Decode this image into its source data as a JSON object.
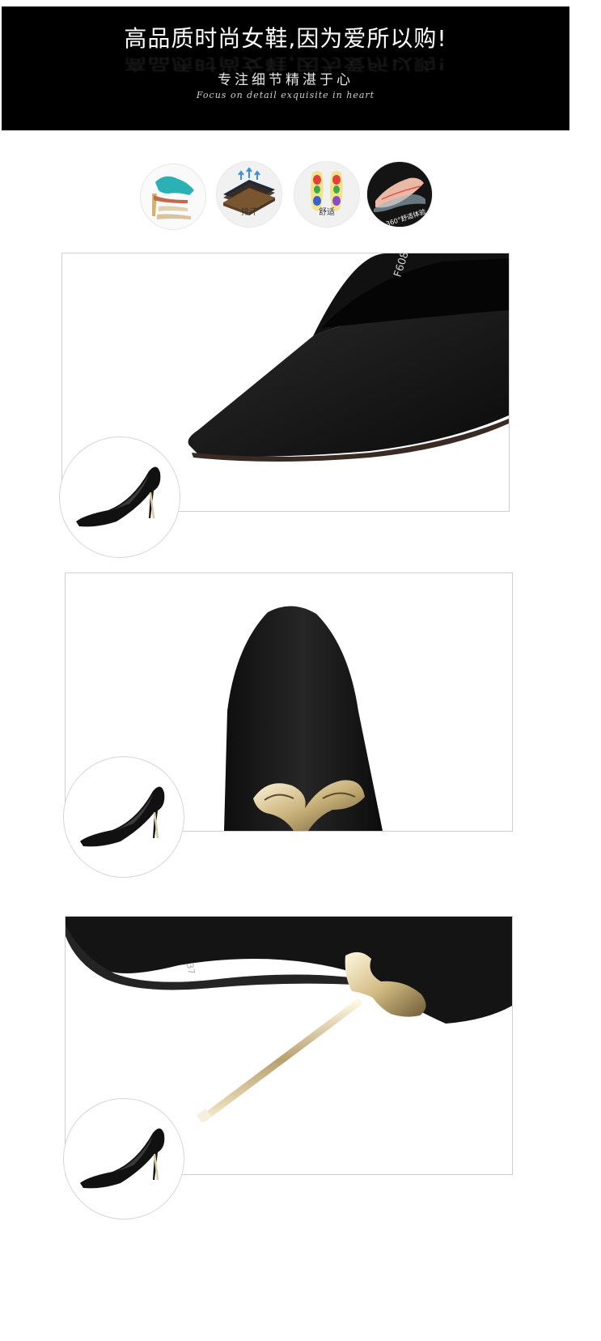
{
  "banner": {
    "title": "高品质时尚女鞋,因为爱所以购!",
    "subtitle_cn": "专注细节精湛于心",
    "subtitle_en": "Focus on detail exquisite in heart"
  },
  "features": [
    {
      "icon": "shoe-last-icon",
      "label": ""
    },
    {
      "icon": "insole-layers-icon",
      "label": "排汗"
    },
    {
      "icon": "foot-pressure-map-icon",
      "label": "舒适"
    },
    {
      "icon": "foot-in-shoe-icon",
      "label": "360°舒适体验"
    }
  ],
  "panels": [
    {
      "image": "black-suede-toe-closeup",
      "code_text": "F608-"
    },
    {
      "image": "heel-back-metal-swan-ornament"
    },
    {
      "image": "metal-stiletto-heel-closeup",
      "sole_text": "37"
    }
  ],
  "colors": {
    "banner_bg": "#000000",
    "suede": "#141414",
    "metal": "#d9c9a0"
  }
}
